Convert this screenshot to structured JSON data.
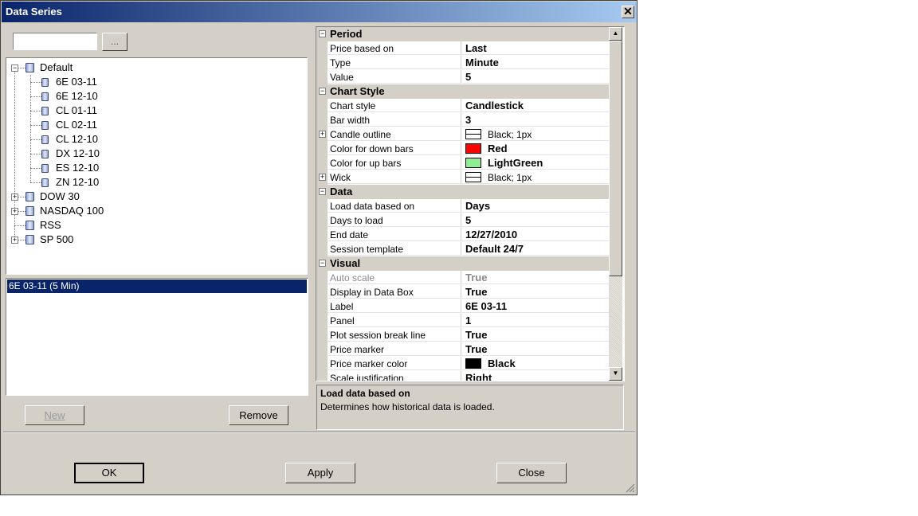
{
  "window": {
    "title": "Data Series"
  },
  "search": {
    "value": "",
    "browse_label": "..."
  },
  "tree": [
    {
      "label": "Default",
      "expanded": true,
      "level": 0
    },
    {
      "label": "6E 03-11",
      "level": 1
    },
    {
      "label": "6E 12-10",
      "level": 1
    },
    {
      "label": "CL 01-11",
      "level": 1
    },
    {
      "label": "CL 02-11",
      "level": 1
    },
    {
      "label": "CL 12-10",
      "level": 1
    },
    {
      "label": "DX 12-10",
      "level": 1
    },
    {
      "label": "ES 12-10",
      "level": 1
    },
    {
      "label": "ZN 12-10",
      "level": 1
    },
    {
      "label": "DOW 30",
      "expanded": false,
      "level": 0
    },
    {
      "label": "NASDAQ 100",
      "expanded": false,
      "level": 0
    },
    {
      "label": "RSS",
      "level": 0
    },
    {
      "label": "SP 500",
      "expanded": false,
      "level": 0
    }
  ],
  "series_list": {
    "items": [
      "6E 03-11 (5 Min)"
    ]
  },
  "buttons": {
    "new": "New",
    "remove": "Remove",
    "ok": "OK",
    "apply": "Apply",
    "close": "Close"
  },
  "properties": [
    {
      "type": "category",
      "label": "Period"
    },
    {
      "name": "Price based on",
      "value": "Last"
    },
    {
      "name": "Type",
      "value": "Minute"
    },
    {
      "name": "Value",
      "value": "5"
    },
    {
      "type": "category",
      "label": "Chart Style"
    },
    {
      "name": "Chart style",
      "value": "Candlestick"
    },
    {
      "name": "Bar width",
      "value": "3"
    },
    {
      "name": "Candle outline",
      "value": "Black; 1px",
      "swatch": "line",
      "expandable": true,
      "plain": true
    },
    {
      "name": "Color for down bars",
      "value": "Red",
      "swatch": "#ff0000"
    },
    {
      "name": "Color for up bars",
      "value": "LightGreen",
      "swatch": "#90ee90"
    },
    {
      "name": "Wick",
      "value": "Black; 1px",
      "swatch": "line",
      "expandable": true,
      "plain": true
    },
    {
      "type": "category",
      "label": "Data"
    },
    {
      "name": "Load data based on",
      "value": "Days"
    },
    {
      "name": "Days to load",
      "value": "5"
    },
    {
      "name": "End date",
      "value": "12/27/2010"
    },
    {
      "name": "Session template",
      "value": "Default 24/7"
    },
    {
      "type": "category",
      "label": "Visual"
    },
    {
      "name": "Auto scale",
      "value": "True",
      "disabled": true
    },
    {
      "name": "Display in Data Box",
      "value": "True"
    },
    {
      "name": "Label",
      "value": "6E 03-11"
    },
    {
      "name": "Panel",
      "value": "1"
    },
    {
      "name": "Plot session break line",
      "value": "True"
    },
    {
      "name": "Price marker",
      "value": "True"
    },
    {
      "name": "Price marker color",
      "value": "Black",
      "swatch": "#000000"
    },
    {
      "name": "Scale justification",
      "value": "Right"
    }
  ],
  "description": {
    "title": "Load data based on",
    "text": "Determines how historical data is loaded."
  },
  "colors": {
    "titlebar_start": "#0a246a",
    "titlebar_end": "#a6caf0",
    "selection": "#0a246a"
  }
}
